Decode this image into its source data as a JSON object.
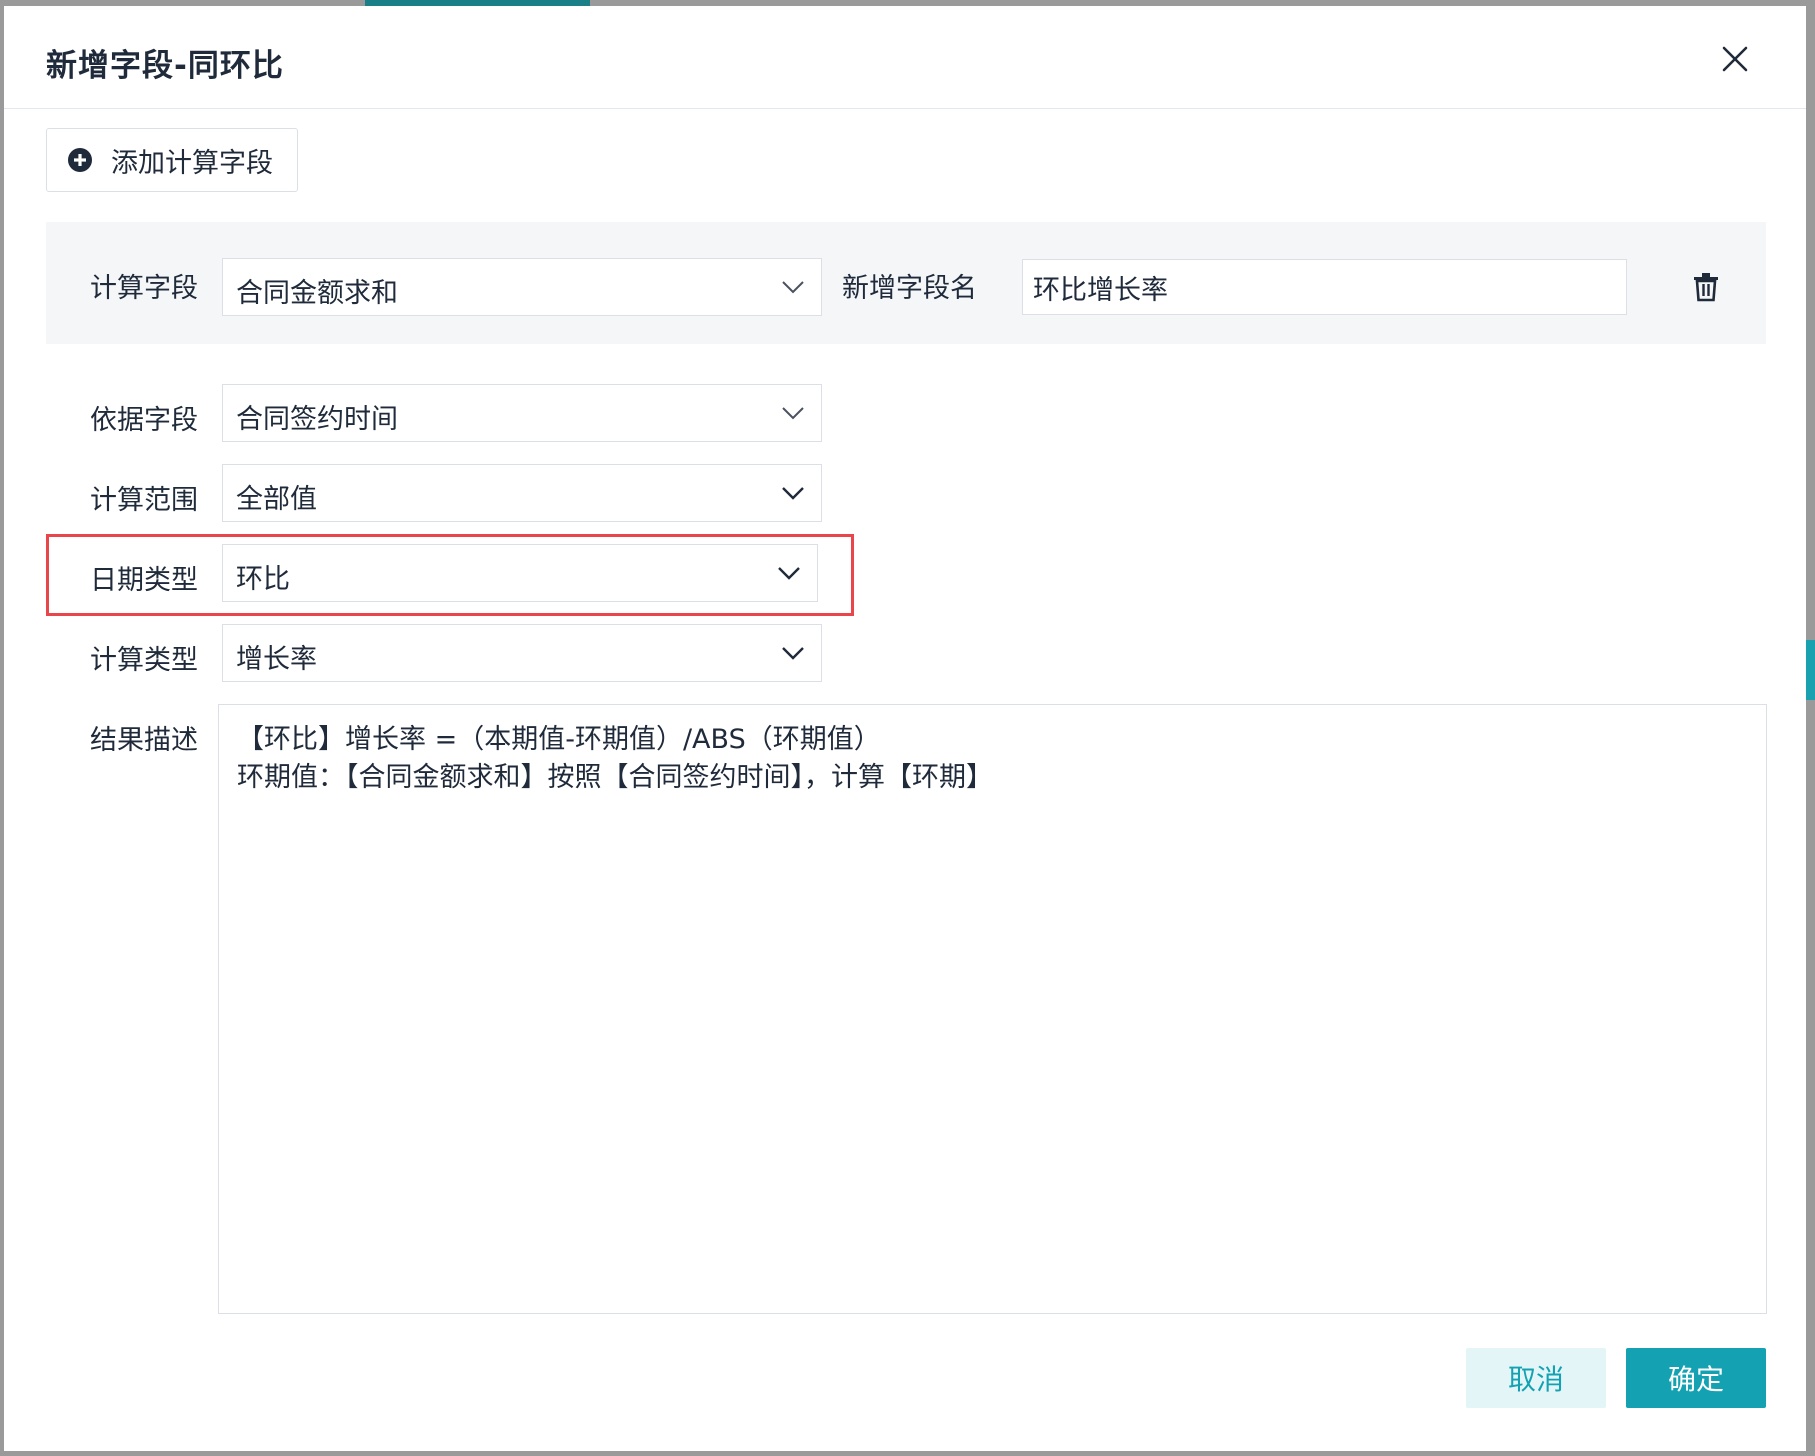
{
  "dialog": {
    "title": "新增字段-同环比",
    "add_button_label": "添加计算字段"
  },
  "calc_field": {
    "label": "计算字段",
    "value": "合同金额求和",
    "new_name_label": "新增字段名",
    "new_name_value": "环比增长率"
  },
  "form": {
    "basis_field": {
      "label": "依据字段",
      "value": "合同签约时间"
    },
    "calc_range": {
      "label": "计算范围",
      "value": "全部值"
    },
    "date_type": {
      "label": "日期类型",
      "value": "环比"
    },
    "calc_type": {
      "label": "计算类型",
      "value": "增长率"
    },
    "result": {
      "label": "结果描述",
      "line1": "【环比】增长率 =（本期值-环期值）/ABS（环期值）",
      "line2": "环期值：【合同金额求和】按照【合同签约时间】，计算【环期】"
    }
  },
  "footer": {
    "cancel_label": "取消",
    "ok_label": "确定"
  },
  "colors": {
    "accent": "#14a2b3",
    "highlight": "#e8464a",
    "panel_bg": "#f5f6f8"
  },
  "icons": {
    "close": "close-icon",
    "add": "plus-circle-icon",
    "dropdown": "chevron-down-icon",
    "delete": "trash-icon"
  }
}
